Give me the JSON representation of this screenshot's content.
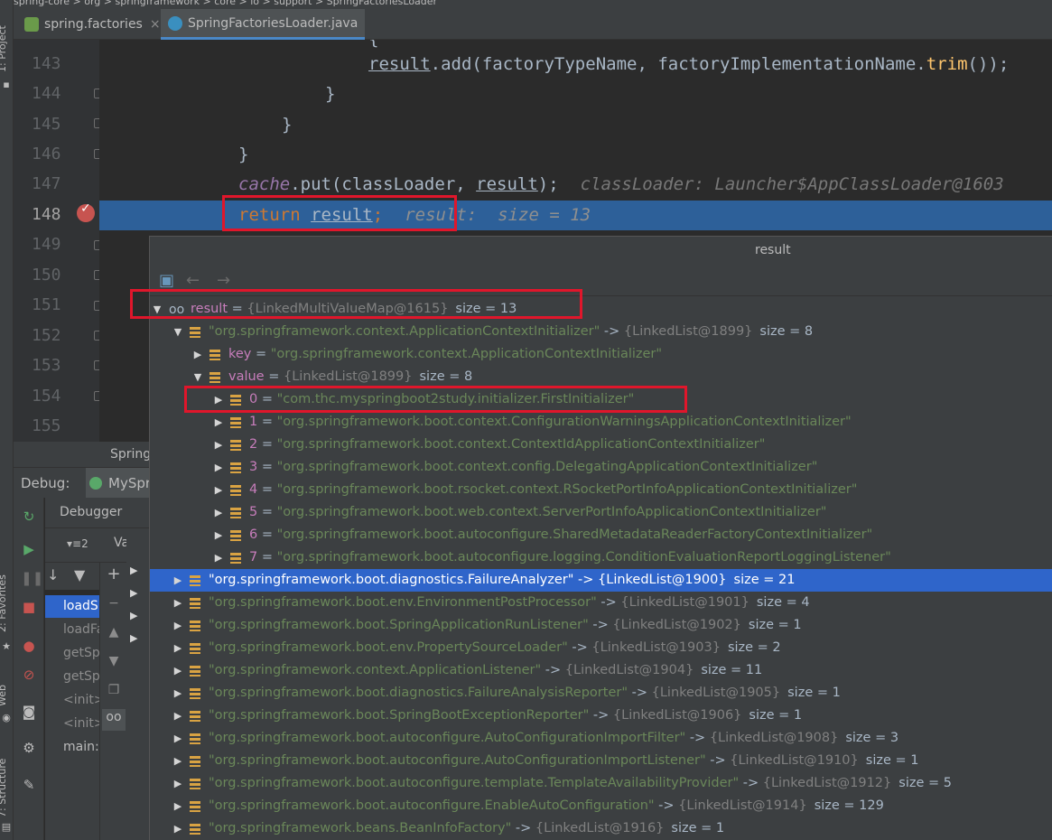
{
  "breadcrumb": "spring-core > org > springframework > core > io > support > SpringFactoriesLoader",
  "left_strip": {
    "project_label": "1: Project",
    "favorites_label": "2: Favorites",
    "web_label": "Web",
    "structure_label": "7: Structure"
  },
  "tabs": [
    {
      "label": "spring.factories",
      "active": false
    },
    {
      "label": "SpringFactoriesLoader.java",
      "active": true
    }
  ],
  "editor": {
    "lines": [
      {
        "no": "143"
      },
      {
        "no": "144"
      },
      {
        "no": "145"
      },
      {
        "no": "146"
      },
      {
        "no": "147"
      },
      {
        "no": "148"
      },
      {
        "no": "149"
      },
      {
        "no": "150"
      },
      {
        "no": "151"
      },
      {
        "no": "152"
      },
      {
        "no": "153"
      },
      {
        "no": "154"
      },
      {
        "no": "155"
      }
    ],
    "line142_partial": "{",
    "line143": {
      "a": "result",
      "b": ".",
      "c": "add",
      "d": "(factoryTypeName, factoryImplementationName.",
      "e": "trim",
      "f": "());"
    },
    "line144": "}",
    "line145": "}",
    "line146": "}",
    "line147": {
      "field": "cache",
      "dot": ".",
      "method": "put",
      "args_a": "(classLoader, ",
      "args_b": "result",
      "args_c": ");",
      "hint": "classLoader: Launcher$AppClassLoader@1603"
    },
    "line148": {
      "kw": "return",
      "var": "result",
      "semi": ";",
      "hint": "result:  size = 13"
    }
  },
  "debug": {
    "run_title": "Spring",
    "label": "Debug:",
    "config_tab": "MySpr",
    "debugger_tab": "Debugger",
    "threads_label": "▾≡2",
    "variables_label": "Variab",
    "frames": [
      {
        "label": "loadSp",
        "selected": true
      },
      {
        "label": "loadFa",
        "selected": false
      },
      {
        "label": "getSp",
        "selected": false
      },
      {
        "label": "getSp",
        "selected": false
      },
      {
        "label": "<init>",
        "selected": false
      },
      {
        "label": "<init>",
        "selected": false
      },
      {
        "label": "main:",
        "selected": false
      }
    ]
  },
  "popup": {
    "title": "result",
    "root": {
      "name": "result",
      "eq": " = ",
      "ref": "{LinkedMultiValueMap@1615}",
      "size": "size = 13"
    },
    "entry0": {
      "key": "\"org.springframework.context.ApplicationContextInitializer\"",
      "arrow": " -> ",
      "ref": "{LinkedList@1899}",
      "size": "size = 8"
    },
    "key_row": {
      "name": "key",
      "eq": " = ",
      "value": "\"org.springframework.context.ApplicationContextInitializer\""
    },
    "value_row": {
      "name": "value",
      "eq": " = ",
      "ref": "{LinkedList@1899}",
      "size": "size = 8"
    },
    "items": [
      {
        "idx": "0",
        "value": "\"com.thc.myspringboot2study.initializer.FirstInitializer\""
      },
      {
        "idx": "1",
        "value": "\"org.springframework.boot.context.ConfigurationWarningsApplicationContextInitializer\""
      },
      {
        "idx": "2",
        "value": "\"org.springframework.boot.context.ContextIdApplicationContextInitializer\""
      },
      {
        "idx": "3",
        "value": "\"org.springframework.boot.context.config.DelegatingApplicationContextInitializer\""
      },
      {
        "idx": "4",
        "value": "\"org.springframework.boot.rsocket.context.RSocketPortInfoApplicationContextInitializer\""
      },
      {
        "idx": "5",
        "value": "\"org.springframework.boot.web.context.ServerPortInfoApplicationContextInitializer\""
      },
      {
        "idx": "6",
        "value": "\"org.springframework.boot.autoconfigure.SharedMetadataReaderFactoryContextInitializer\""
      },
      {
        "idx": "7",
        "value": "\"org.springframework.boot.autoconfigure.logging.ConditionEvaluationReportLoggingListener\""
      }
    ],
    "entries": [
      {
        "key": "\"org.springframework.boot.diagnostics.FailureAnalyzer\"",
        "ref": "{LinkedList@1900}",
        "size": "size = 21",
        "selected": true
      },
      {
        "key": "\"org.springframework.boot.env.EnvironmentPostProcessor\"",
        "ref": "{LinkedList@1901}",
        "size": "size = 4",
        "selected": false
      },
      {
        "key": "\"org.springframework.boot.SpringApplicationRunListener\"",
        "ref": "{LinkedList@1902}",
        "size": "size = 1",
        "selected": false
      },
      {
        "key": "\"org.springframework.boot.env.PropertySourceLoader\"",
        "ref": "{LinkedList@1903}",
        "size": "size = 2",
        "selected": false
      },
      {
        "key": "\"org.springframework.context.ApplicationListener\"",
        "ref": "{LinkedList@1904}",
        "size": "size = 11",
        "selected": false
      },
      {
        "key": "\"org.springframework.boot.diagnostics.FailureAnalysisReporter\"",
        "ref": "{LinkedList@1905}",
        "size": "size = 1",
        "selected": false
      },
      {
        "key": "\"org.springframework.boot.SpringBootExceptionReporter\"",
        "ref": "{LinkedList@1906}",
        "size": "size = 1",
        "selected": false
      },
      {
        "key": "\"org.springframework.boot.autoconfigure.AutoConfigurationImportFilter\"",
        "ref": "{LinkedList@1908}",
        "size": "size = 3",
        "selected": false
      },
      {
        "key": "\"org.springframework.boot.autoconfigure.AutoConfigurationImportListener\"",
        "ref": "{LinkedList@1910}",
        "size": "size = 1",
        "selected": false
      },
      {
        "key": "\"org.springframework.boot.autoconfigure.template.TemplateAvailabilityProvider\"",
        "ref": "{LinkedList@1912}",
        "size": "size = 5",
        "selected": false
      },
      {
        "key": "\"org.springframework.boot.autoconfigure.EnableAutoConfiguration\"",
        "ref": "{LinkedList@1914}",
        "size": "size = 129",
        "selected": false
      },
      {
        "key": "\"org.springframework.beans.BeanInfoFactory\"",
        "ref": "{LinkedList@1916}",
        "size": "size = 1",
        "selected": false
      }
    ]
  },
  "colors": {
    "selection": "#2f65ca",
    "current_line": "#2d6099",
    "annotation_red": "#e0162b"
  }
}
